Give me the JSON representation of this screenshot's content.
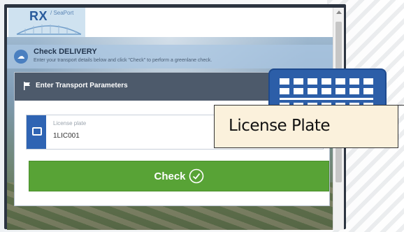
{
  "app": {
    "logo": "RX",
    "logo_suffix": "/ SeaPort"
  },
  "header": {
    "title": "Check DELIVERY",
    "subtitle": "Enter your transport details below and click \"Check\" to perform a greenlane check."
  },
  "panel": {
    "title": "Enter Transport Parameters",
    "license_plate_label": "License plate",
    "license_plate_value": "1LIC001"
  },
  "actions": {
    "check_label": "Check"
  },
  "annotation": {
    "text": "License Plate"
  },
  "colors": {
    "accent_blue": "#2f64b3",
    "panel_head": "#4d5a6b",
    "check_green": "#58a336",
    "callout_bg": "#fbf1dc"
  },
  "icons": [
    "cloud-icon",
    "flag-icon",
    "license-plate-icon",
    "check-circle-icon",
    "license-plate-badge-icon"
  ]
}
